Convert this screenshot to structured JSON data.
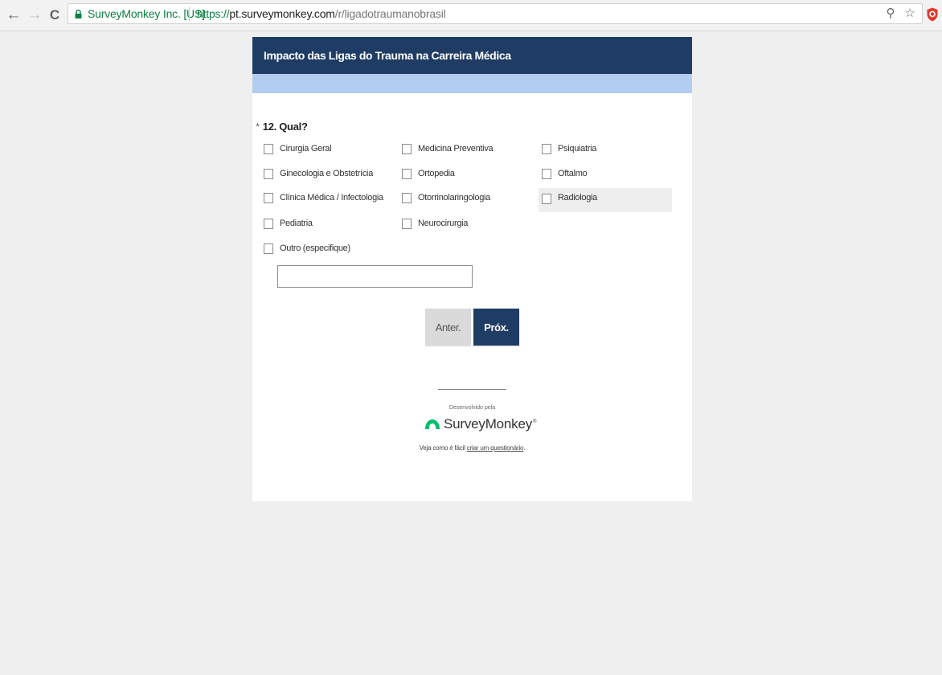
{
  "browser": {
    "back_icon": "←",
    "forward_icon": "→",
    "reload_icon": "C",
    "site_identity": "SurveyMonkey Inc. [US]",
    "url_scheme": "https://",
    "url_host": "pt.surveymonkey.com",
    "url_path": "/r/ligadotraumanobrasil",
    "zoom_icon": "⚲",
    "bookmark_icon": "☆"
  },
  "survey": {
    "title": "Impacto das Ligas do Trauma na Carreira Médica",
    "question": {
      "required_mark": "*",
      "number": "12.",
      "text": "Qual?"
    },
    "options": [
      "Cirurgia Geral",
      "Ginecologia e Obstetrícia",
      "Clínica Médica / Infectologia",
      "Pediatria",
      "Outro (especifique)",
      "Medicina Preventiva",
      "Ortopedia",
      "Otorrinolaringologia",
      "Neurocirurgia",
      "Psiquiatria",
      "Oftalmo",
      "Radiologia"
    ],
    "other_value": "",
    "prev_label": "Anter.",
    "next_label": "Próx."
  },
  "footer": {
    "powered_by": "Desenvolvido pela",
    "brand": "SurveyMonkey",
    "brand_mark": "®",
    "cta_prefix": "Veja como é fácil ",
    "cta_link": "criar um questionário",
    "cta_suffix": "."
  },
  "colors": {
    "header": "#1f3c64",
    "progress_band": "#b1cdf0",
    "brand_green": "#00bf6f",
    "secure_green": "#0b8043"
  }
}
